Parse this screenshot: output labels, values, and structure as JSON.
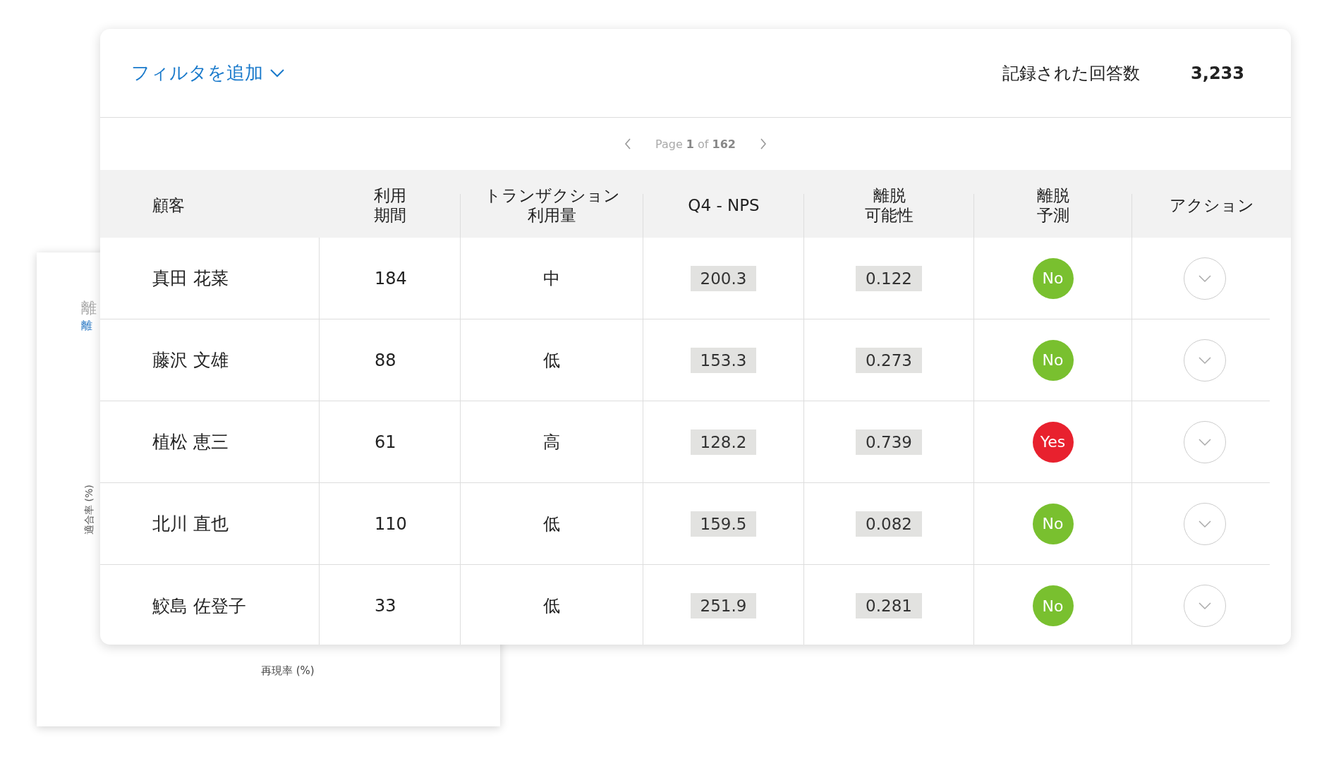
{
  "back_panel": {
    "title": "離",
    "subtitle": "離",
    "y_axis_label": "適合率 (%)",
    "x_axis_label": "再現率 (%)"
  },
  "header": {
    "filter_link": "フィルタを追加",
    "responses_label": "記録された回答数",
    "responses_count": "3,233"
  },
  "pagination": {
    "text": "Page **1** of **162**"
  },
  "table": {
    "columns": [
      [
        "顧客"
      ],
      [
        "利用",
        "期間"
      ],
      [
        "トランザクション",
        "利用量"
      ],
      [
        "Q4 - NPS"
      ],
      [
        "離脱",
        "可能性"
      ],
      [
        "離脱",
        "予測"
      ],
      [
        "アクション"
      ]
    ],
    "rows": [
      {
        "customer": "真田 花菜",
        "tenure": "184",
        "usage": "中",
        "nps": "200.3",
        "churn_probability": "0.122",
        "churn_prediction": {
          "label": "No",
          "churn": false
        }
      },
      {
        "customer": "藤沢 文雄",
        "tenure": "88",
        "usage": "低",
        "nps": "153.3",
        "churn_probability": "0.273",
        "churn_prediction": {
          "label": "No",
          "churn": false
        }
      },
      {
        "customer": "植松 恵三",
        "tenure": "61",
        "usage": "高",
        "nps": "128.2",
        "churn_probability": "0.739",
        "churn_prediction": {
          "label": "Yes",
          "churn": true
        }
      },
      {
        "customer": "北川 直也",
        "tenure": "110",
        "usage": "低",
        "nps": "159.5",
        "churn_probability": "0.082",
        "churn_prediction": {
          "label": "No",
          "churn": false
        }
      },
      {
        "customer": "鮫島 佐登子",
        "tenure": "33",
        "usage": "低",
        "nps": "251.9",
        "churn_probability": "0.281",
        "churn_prediction": {
          "label": "No",
          "churn": false
        }
      }
    ]
  }
}
